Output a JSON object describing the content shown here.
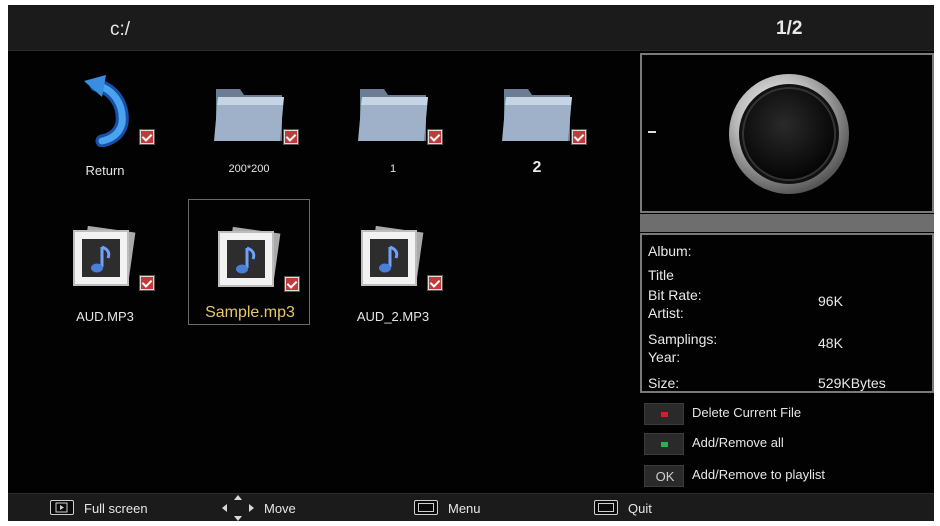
{
  "header": {
    "path": "c:/",
    "page": "1/2"
  },
  "items": [
    {
      "label": "Return",
      "icon": "return-arrow-icon"
    },
    {
      "label": "200*200",
      "icon": "folder-icon"
    },
    {
      "label": "1",
      "icon": "folder-icon"
    },
    {
      "label": "2",
      "icon": "folder-icon"
    },
    {
      "label": "AUD.MP3",
      "icon": "music-file-icon"
    },
    {
      "label": "Sample.mp3",
      "icon": "music-file-icon",
      "selected": true
    },
    {
      "label": "AUD_2.MP3",
      "icon": "music-file-icon"
    }
  ],
  "preview": {
    "marker": "-",
    "icon": "speaker-icon"
  },
  "info": {
    "album_label": "Album:",
    "title_label": "Title",
    "bitrate_label": "Bit Rate:",
    "bitrate_value": "96K",
    "artist_label": "Artist:",
    "samplings_label": "Samplings:",
    "samplings_value": "48K",
    "year_label": "Year:",
    "size_label": "Size:",
    "size_value": "529KBytes"
  },
  "legend": {
    "red_label": "Delete Current File",
    "green_label": "Add/Remove all",
    "ok_key": "OK",
    "ok_label": "Add/Remove to playlist"
  },
  "footer": {
    "fullscreen": "Full screen",
    "move": "Move",
    "menu": "Menu",
    "quit": "Quit"
  },
  "colors": {
    "red_key": "#d0202a",
    "green_key": "#1fb84a",
    "selected_text": "#e6c86a",
    "note_blue": "#4a7fd8"
  }
}
